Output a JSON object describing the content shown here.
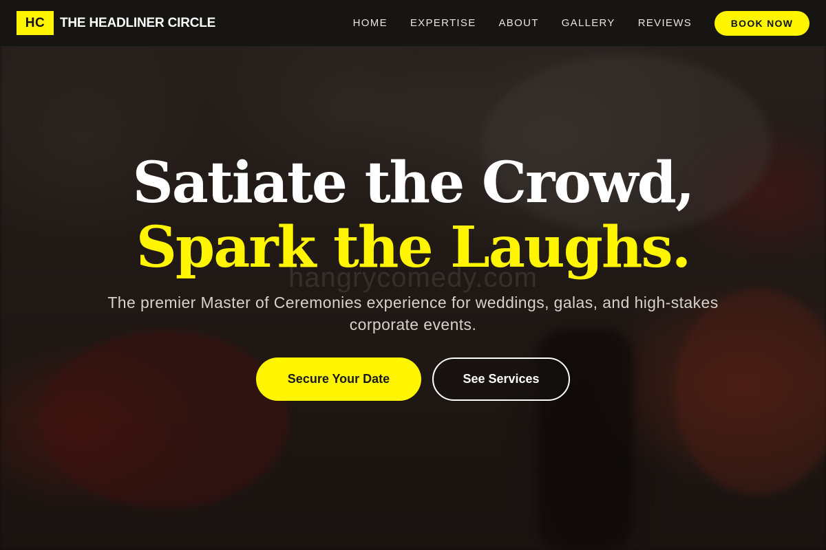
{
  "brand": {
    "mark": "HC",
    "name": "THE HEADLINER CIRCLE"
  },
  "nav": {
    "links": [
      "HOME",
      "EXPERTISE",
      "ABOUT",
      "GALLERY",
      "REVIEWS"
    ],
    "cta_label": "BOOK NOW"
  },
  "hero": {
    "headline_line1": "Satiate the Crowd,",
    "headline_line2": "Spark the Laughs.",
    "watermark": "hangrycomedy.com",
    "subtitle": "The premier Master of Ceremonies experience for weddings, galas, and high-stakes corporate events.",
    "primary_cta": "Secure Your Date",
    "secondary_cta": "See Services"
  },
  "colors": {
    "accent": "#fff500",
    "nav_bg": "#161413",
    "text_light": "#ffffff",
    "subtitle_text": "#d6d1cb"
  }
}
